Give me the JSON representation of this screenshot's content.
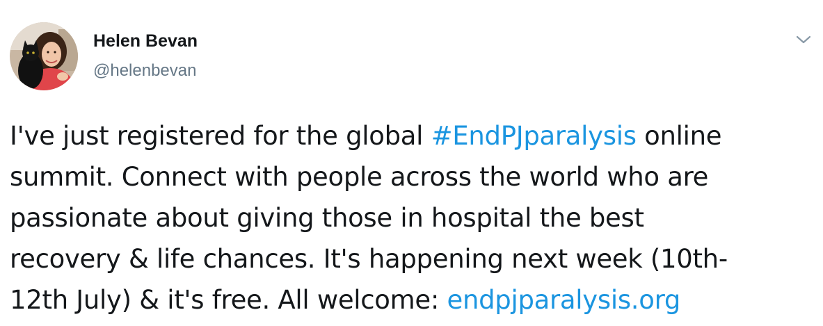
{
  "tweet": {
    "author": {
      "name": "Helen Bevan",
      "handle": "@helenbevan"
    },
    "menu_icon": "chevron-down-icon",
    "body_lines": [
      [
        {
          "text": "I've just registered for the global ",
          "type": "text"
        },
        {
          "text": "#EndPJparalysis",
          "type": "hashtag"
        },
        {
          "text": " online",
          "type": "text"
        }
      ],
      [
        {
          "text": "summit. Connect with people across the world who are",
          "type": "text"
        }
      ],
      [
        {
          "text": "passionate about giving those in hospital the best",
          "type": "text"
        }
      ],
      [
        {
          "text": "recovery & life chances. It's happening next week (10th-",
          "type": "text"
        }
      ],
      [
        {
          "text": "12th July) & it's free. All welcome: ",
          "type": "text"
        },
        {
          "text": "endpjparalysis.org",
          "type": "link"
        }
      ]
    ]
  },
  "colors": {
    "text": "#14171a",
    "secondary_text": "#657786",
    "link": "#1b95e0",
    "caret": "#8899a6"
  }
}
